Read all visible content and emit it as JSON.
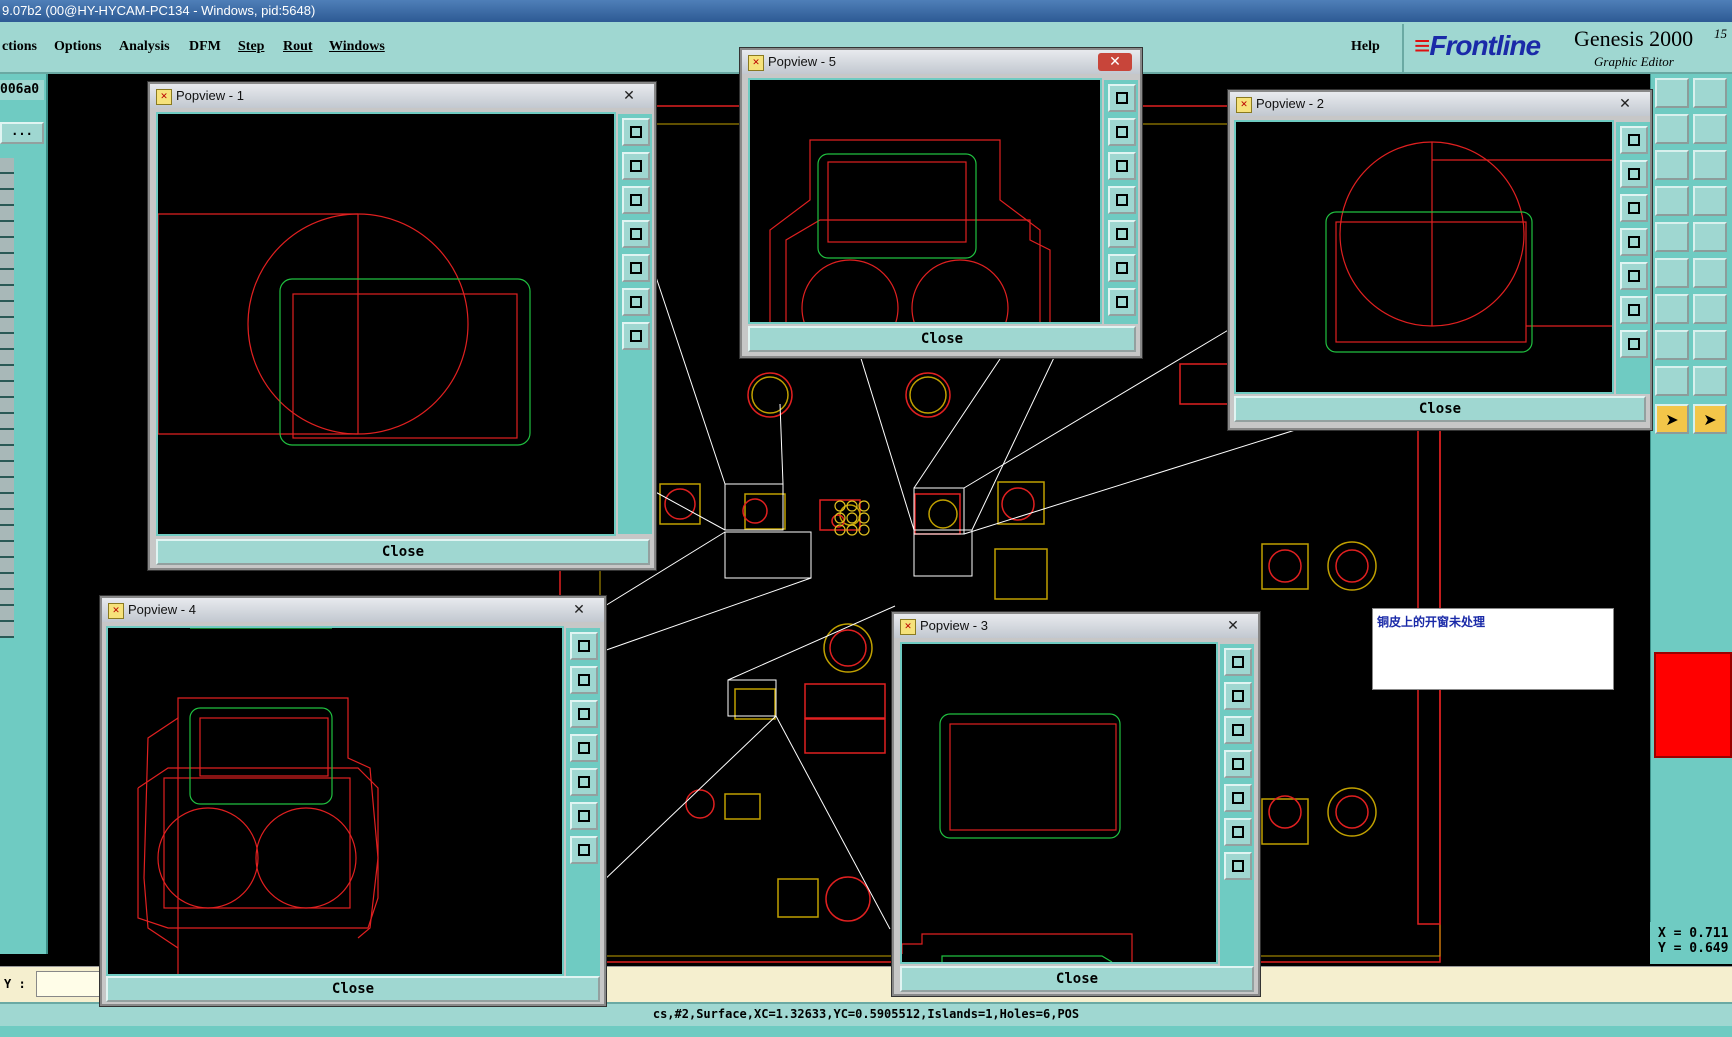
{
  "window": {
    "title": "9.07b2 (00@HY-HYCAM-PC134 - Windows, pid:5648)"
  },
  "menu": {
    "items": [
      "ctions",
      "Options",
      "Analysis",
      "DFM",
      "Step",
      "Rout",
      "Windows"
    ],
    "help": "Help"
  },
  "brand": {
    "name": "Frontline",
    "product": "Genesis 2000",
    "subtitle": "Graphic Editor",
    "version_fragment": "15",
    "version_fragment2": "0"
  },
  "left_panel": {
    "job_field": "006a0",
    "dots_button": "..."
  },
  "popups": [
    {
      "title": "Popview - 1",
      "close_label": "Close"
    },
    {
      "title": "Popview - 5",
      "close_label": "Close"
    },
    {
      "title": "Popview - 2",
      "close_label": "Close"
    },
    {
      "title": "Popview - 4",
      "close_label": "Close"
    },
    {
      "title": "Popview - 3",
      "close_label": "Close"
    }
  ],
  "close_glyph": "✕",
  "note": {
    "text": "铜皮上的开窗未处理"
  },
  "coords": {
    "x": "X = 0.711",
    "y": "Y = 0.649"
  },
  "input": {
    "label": "Y :",
    "value": ""
  },
  "status": {
    "text": "cs,#2,Surface,XC=1.32633,YC=0.5905512,Islands=1,Holes=6,POS"
  },
  "colors": {
    "accent": "#6fcbc2",
    "menu": "#9fd7d1",
    "board_red": "#e02020",
    "board_green": "#20c040",
    "highlight": "#f3c649"
  }
}
